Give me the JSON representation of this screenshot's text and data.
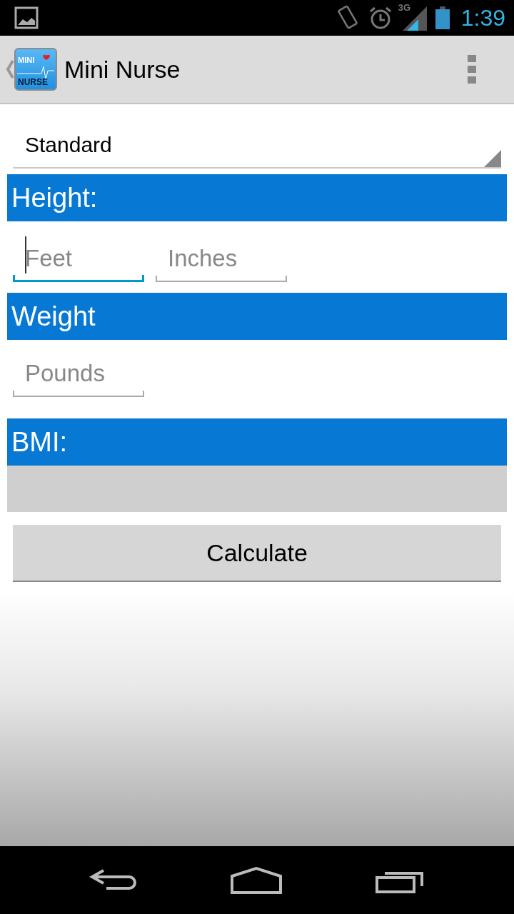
{
  "status_bar": {
    "time": "1:39",
    "network": "3G"
  },
  "action_bar": {
    "logo": {
      "line_1": "MINI",
      "line_2": "NURSE"
    },
    "title": "Mini Nurse"
  },
  "unit_spinner": {
    "value": "Standard"
  },
  "height": {
    "label": "Height:",
    "fields": [
      {
        "placeholder": "Feet",
        "focused": true
      },
      {
        "placeholder": "Inches",
        "focused": false
      }
    ]
  },
  "weight": {
    "label": "Weight",
    "fields": [
      {
        "placeholder": "Pounds",
        "focused": false
      }
    ]
  },
  "bmi": {
    "label": "BMI:"
  },
  "buttons": [
    "Calculate"
  ]
}
